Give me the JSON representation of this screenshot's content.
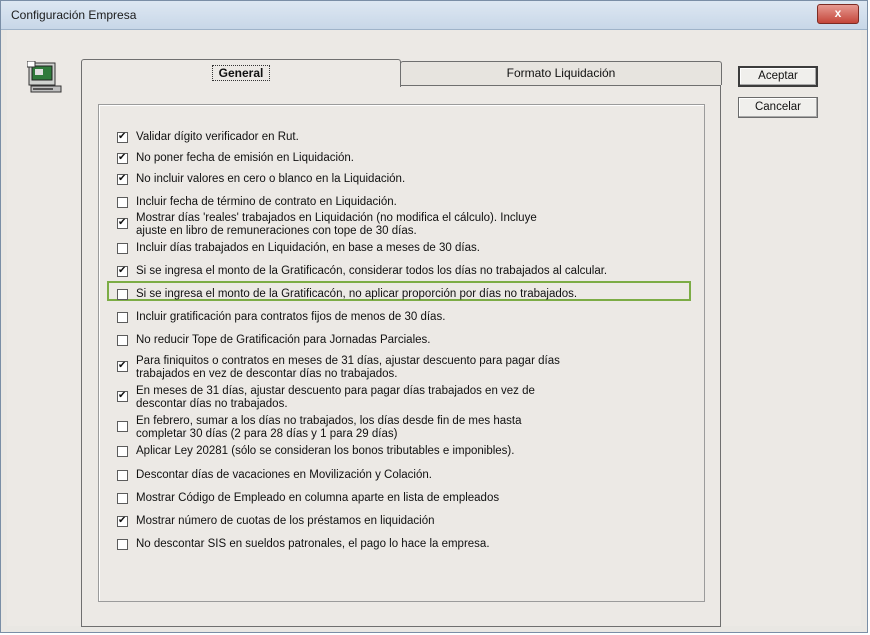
{
  "window": {
    "title": "Configuración Empresa",
    "close_label": "x"
  },
  "tabs": [
    {
      "label": "General"
    },
    {
      "label": "Formato Liquidación"
    }
  ],
  "buttons": {
    "accept": "Aceptar",
    "cancel": "Cancelar"
  },
  "options": [
    {
      "checked": true,
      "lines": [
        "Validar dígito verificador en Rut."
      ]
    },
    {
      "checked": true,
      "lines": [
        "No poner fecha de emisión en Liquidación."
      ]
    },
    {
      "checked": true,
      "lines": [
        "No incluir valores en cero o blanco en la Liquidación."
      ]
    },
    {
      "checked": false,
      "lines": [
        "Incluir fecha de término de contrato en Liquidación."
      ]
    },
    {
      "checked": true,
      "lines": [
        "Mostrar días 'reales' trabajados en Liquidación (no modifica el cálculo). Incluye",
        "ajuste en libro de remuneraciones con tope de 30 días."
      ]
    },
    {
      "checked": false,
      "lines": [
        "Incluir días trabajados en Liquidación, en base a meses de 30 días."
      ]
    },
    {
      "checked": true,
      "lines": [
        "Si se ingresa el monto de la Gratificacón, considerar todos los días no trabajados al calcular."
      ]
    },
    {
      "checked": false,
      "lines": [
        "Si se ingresa el monto de la Gratificacón, no aplicar proporción por días no trabajados."
      ]
    },
    {
      "checked": false,
      "lines": [
        "Incluir gratificación para contratos fijos de menos de 30 días."
      ]
    },
    {
      "checked": false,
      "lines": [
        "No reducir Tope de Gratificación para Jornadas Parciales."
      ]
    },
    {
      "checked": true,
      "lines": [
        "Para finiquitos o contratos en meses de 31 días, ajustar descuento para pagar días",
        "trabajados en vez de descontar días no trabajados."
      ]
    },
    {
      "checked": true,
      "lines": [
        "En meses de 31 días, ajustar descuento para pagar días trabajados en vez de",
        "descontar días no trabajados."
      ]
    },
    {
      "checked": false,
      "lines": [
        "En febrero, sumar a los días no trabajados, los días desde fin de mes hasta",
        "completar 30 días (2 para 28 días y 1 para 29 días)"
      ]
    },
    {
      "checked": false,
      "lines": [
        "Aplicar Ley 20281 (sólo se consideran los bonos tributables e imponibles)."
      ]
    },
    {
      "checked": false,
      "lines": [
        "Descontar días de vacaciones en Movilización y Colación."
      ]
    },
    {
      "checked": false,
      "lines": [
        "Mostrar Código de Empleado en columna aparte en lista de empleados"
      ]
    },
    {
      "checked": true,
      "lines": [
        "Mostrar  número de cuotas de los préstamos en liquidación"
      ]
    },
    {
      "checked": false,
      "lines": [
        "No descontar SIS en sueldos patronales, el pago lo hace la empresa."
      ]
    }
  ]
}
